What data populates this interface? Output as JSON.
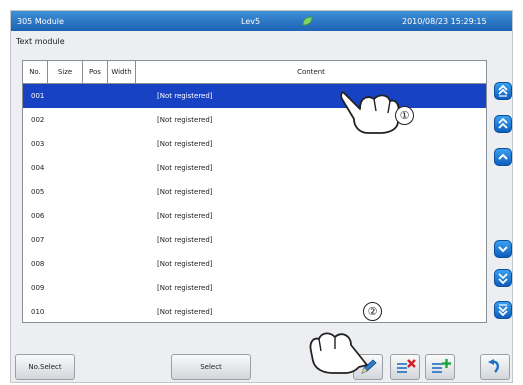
{
  "header": {
    "module": "305 Module",
    "level": "Lev5",
    "datetime": "2010/08/23 15:29:15"
  },
  "page_title": "Text module",
  "table": {
    "columns": [
      "No.",
      "Size",
      "Pos",
      "Width",
      "Content"
    ],
    "rows": [
      {
        "no": "001",
        "content": "[Not registered]"
      },
      {
        "no": "002",
        "content": "[Not registered]"
      },
      {
        "no": "003",
        "content": "[Not registered]"
      },
      {
        "no": "004",
        "content": "[Not registered]"
      },
      {
        "no": "005",
        "content": "[Not registered]"
      },
      {
        "no": "006",
        "content": "[Not registered]"
      },
      {
        "no": "007",
        "content": "[Not registered]"
      },
      {
        "no": "008",
        "content": "[Not registered]"
      },
      {
        "no": "009",
        "content": "[Not registered]"
      },
      {
        "no": "010",
        "content": "[Not registered]"
      }
    ],
    "selected_index": 0
  },
  "scroll_buttons": [
    "scroll-top-icon",
    "page-up-icon",
    "line-up-icon",
    "line-down-icon",
    "page-down-icon",
    "scroll-bottom-icon"
  ],
  "footer": {
    "no_select_label": "No.Select",
    "select_label": "Select",
    "icons": [
      "edit-pencil-icon",
      "delete-icon",
      "add-icon",
      "back-icon"
    ]
  },
  "callouts": {
    "one": "①",
    "two": "②"
  },
  "colors": {
    "titlebar": "#1e62b4",
    "selected_row": "#1842c4",
    "scroll_button": "#0d5fbe"
  }
}
